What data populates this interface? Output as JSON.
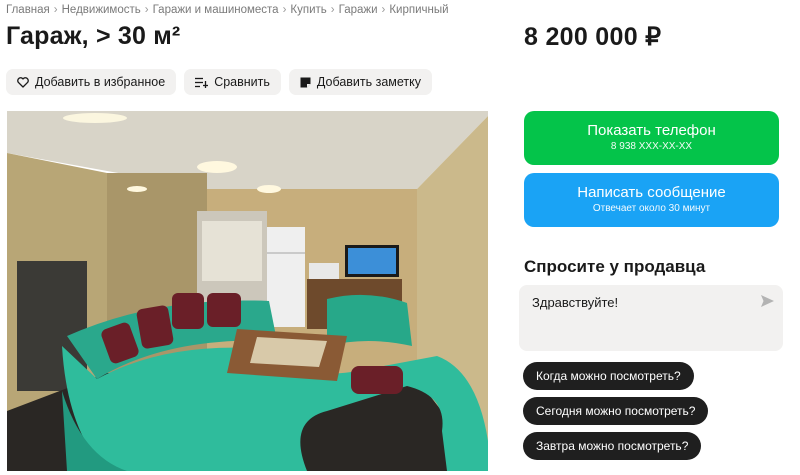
{
  "breadcrumb": [
    "Главная",
    "Недвижимость",
    "Гаражи и машиноместа",
    "Купить",
    "Гаражи",
    "Кирпичный"
  ],
  "listing": {
    "title": "Гараж, > 30 м²",
    "price": "8 200 000 ₽"
  },
  "actions": {
    "favorite": "Добавить в избранное",
    "compare": "Сравнить",
    "note": "Добавить заметку"
  },
  "contact": {
    "phone_label": "Показать телефон",
    "phone_masked": "8 938 XXX-XX-XX",
    "message_label": "Написать сообщение",
    "message_sub": "Отвечает около 30 минут"
  },
  "ask": {
    "title": "Спросите у продавца",
    "message_value": "Здравствуйте!",
    "quick_questions": [
      "Когда можно посмотреть?",
      "Сегодня можно посмотреть?",
      "Завтра можно посмотреть?"
    ]
  },
  "colors": {
    "phone_button": "#04c44a",
    "message_button": "#1aa3f5",
    "chip_bg": "#f2f1f0",
    "quick_chip_bg": "#1f1f1f"
  },
  "icons": [
    "heart-icon",
    "compare-icon",
    "note-icon",
    "send-icon"
  ]
}
